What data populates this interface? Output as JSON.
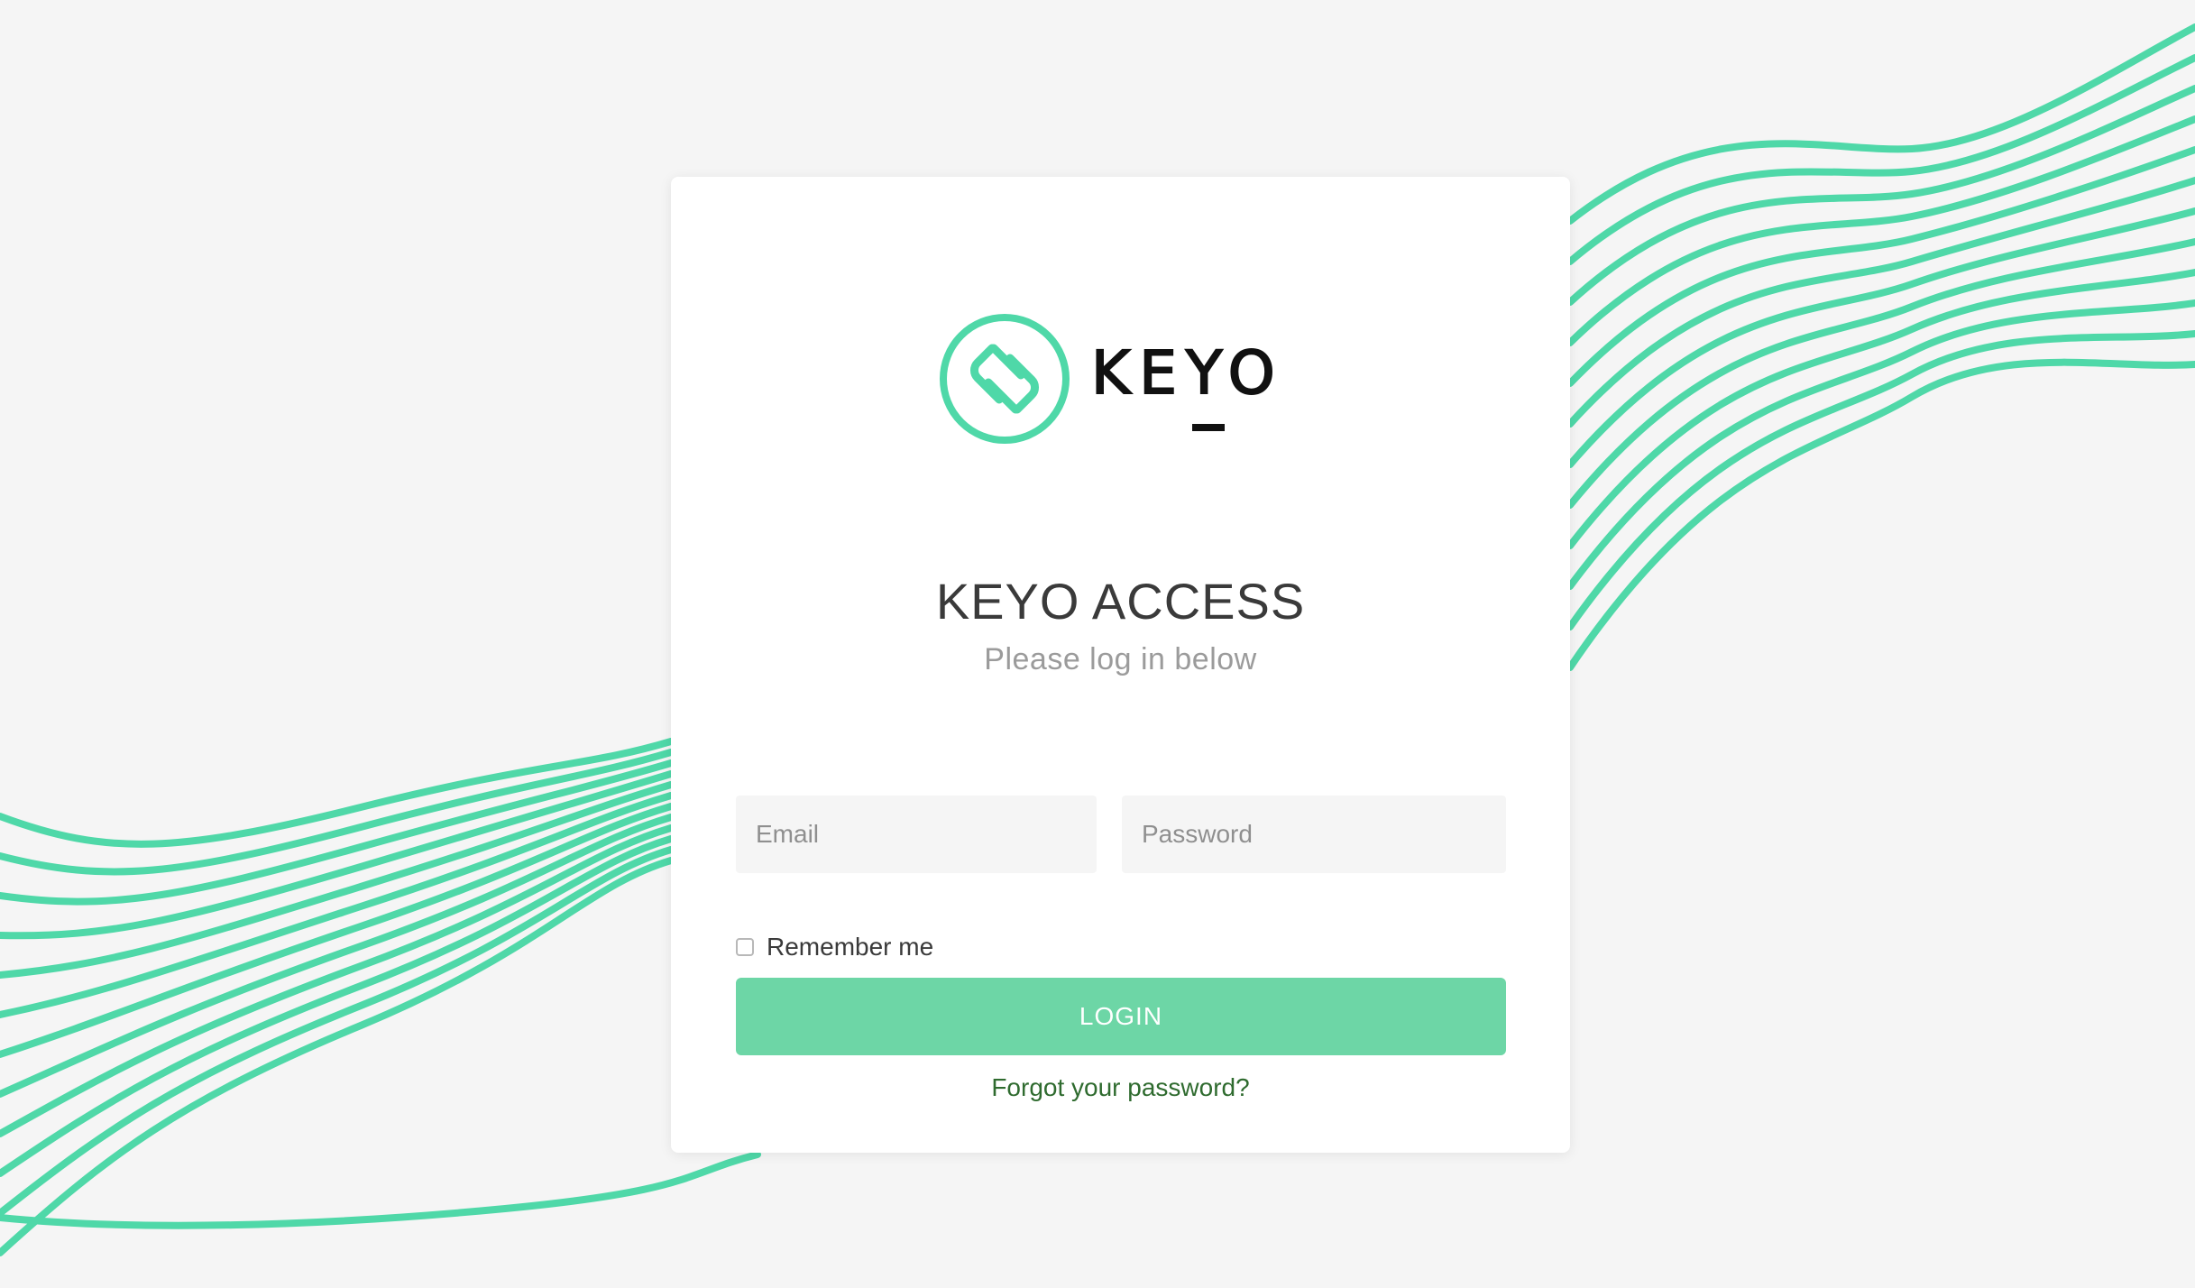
{
  "brand": {
    "name": "KEYO",
    "accent_color": "#4fd8a8",
    "button_color": "#6dd6a6"
  },
  "login": {
    "title": "KEYO ACCESS",
    "subtitle": "Please log in below",
    "email_placeholder": "Email",
    "password_placeholder": "Password",
    "remember_label": "Remember me",
    "remember_checked": false,
    "login_label": "LOGIN",
    "forgot_label": "Forgot your password?"
  },
  "icons": {
    "logo_mark": "keyo-logo-icon",
    "background": "wave-lines-decoration"
  }
}
